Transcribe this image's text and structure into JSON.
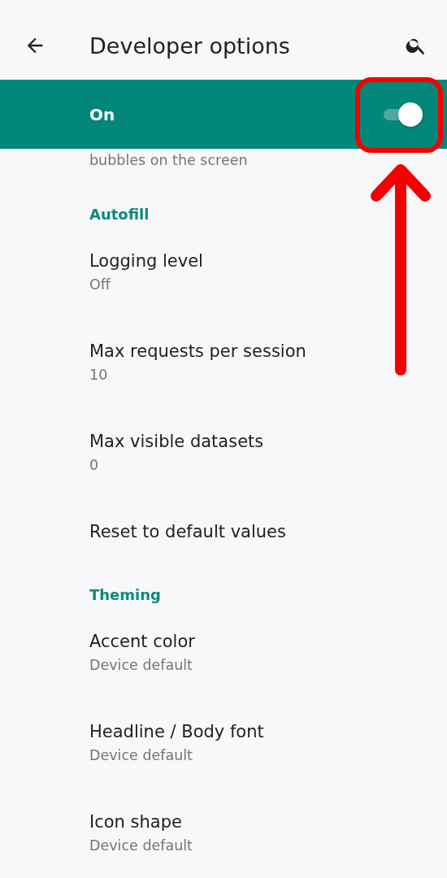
{
  "app_bar": {
    "title": "Developer options"
  },
  "master_switch": {
    "label": "On",
    "on": true
  },
  "cut_off_summary": "bubbles on the screen",
  "sections": [
    {
      "header": "Autofill",
      "items": [
        {
          "title": "Logging level",
          "summary": "Off"
        },
        {
          "title": "Max requests per session",
          "summary": "10"
        },
        {
          "title": "Max visible datasets",
          "summary": "0"
        },
        {
          "title": "Reset to default values"
        }
      ]
    },
    {
      "header": "Theming",
      "items": [
        {
          "title": "Accent color",
          "summary": "Device default"
        },
        {
          "title": "Headline / Body font",
          "summary": "Device default"
        },
        {
          "title": "Icon shape",
          "summary": "Device default"
        }
      ]
    }
  ]
}
